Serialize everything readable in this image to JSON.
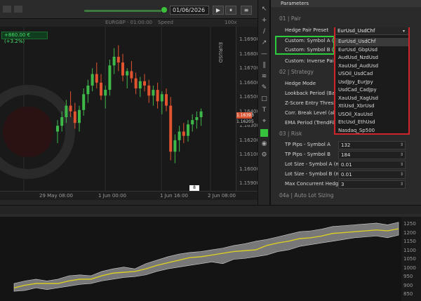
{
  "toolbar": {
    "date": "01/06/2026",
    "play_label": "▶",
    "pause_label": "⏸",
    "more_label": "≡"
  },
  "subbar": {
    "instrument": "EURGBP · 01:00:00",
    "speed_label": "Speed",
    "speed_value": "100x"
  },
  "chart": {
    "pnl_badge": "+860.00 € (+3.2%)",
    "vertical_label": "EURUSD",
    "price_marker": "1.16393",
    "price_marker_2": "1.16205",
    "small_marker": "8",
    "price_ticks": [
      "1.16900",
      "1.16800",
      "1.16700",
      "1.16600",
      "1.16500",
      "1.16400",
      "1.16300",
      "1.16200",
      "1.16100",
      "1.16000",
      "1.15900"
    ],
    "time_ticks": [
      "29 May 08:00",
      "1 Jun 00:00",
      "1 Jun 16:00",
      "2 Jun 08:00"
    ],
    "toolstrip_icons": [
      "cursor-icon",
      "crosshair-icon",
      "line-icon",
      "ray-icon",
      "hline-icon",
      "channel-icon",
      "fib-icon",
      "brush-icon",
      "shape-icon",
      "text-icon",
      "measure-icon",
      "color-swatch-icon",
      "camera-icon",
      "settings-icon"
    ],
    "candles": [
      [
        1.162,
        1.1628,
        1.1612,
        1.1624
      ],
      [
        1.1624,
        1.1634,
        1.162,
        1.163
      ],
      [
        1.163,
        1.1642,
        1.1626,
        1.1638
      ],
      [
        1.1638,
        1.1648,
        1.163,
        1.1634
      ],
      [
        1.1634,
        1.164,
        1.1622,
        1.1626
      ],
      [
        1.1626,
        1.1638,
        1.162,
        1.1635
      ],
      [
        1.1635,
        1.165,
        1.1631,
        1.1646
      ],
      [
        1.1646,
        1.1656,
        1.164,
        1.1652
      ],
      [
        1.1652,
        1.1664,
        1.1648,
        1.166
      ],
      [
        1.166,
        1.1668,
        1.165,
        1.1654
      ],
      [
        1.1654,
        1.166,
        1.1642,
        1.1645
      ],
      [
        1.1645,
        1.1652,
        1.1636,
        1.1649
      ],
      [
        1.1649,
        1.167,
        1.1645,
        1.1666
      ],
      [
        1.1666,
        1.1678,
        1.166,
        1.1672
      ],
      [
        1.1672,
        1.168,
        1.1662,
        1.1668
      ],
      [
        1.1668,
        1.1674,
        1.1655,
        1.1659
      ],
      [
        1.1659,
        1.1664,
        1.165,
        1.1662
      ],
      [
        1.1662,
        1.1669,
        1.1654,
        1.1657
      ],
      [
        1.1657,
        1.1661,
        1.1646,
        1.165
      ],
      [
        1.165,
        1.1658,
        1.1644,
        1.1655
      ],
      [
        1.1655,
        1.166,
        1.1648,
        1.1652
      ],
      [
        1.1652,
        1.1656,
        1.164,
        1.1645
      ],
      [
        1.1645,
        1.1652,
        1.1638,
        1.1649
      ],
      [
        1.1649,
        1.1654,
        1.1636,
        1.1641
      ],
      [
        1.1641,
        1.1648,
        1.1632,
        1.1646
      ],
      [
        1.1646,
        1.165,
        1.1634,
        1.1638
      ],
      [
        1.1638,
        1.1644,
        1.16,
        1.1606
      ],
      [
        1.1606,
        1.1618,
        1.1598,
        1.1614
      ],
      [
        1.1614,
        1.1624,
        1.1606,
        1.162
      ],
      [
        1.162,
        1.1626,
        1.1612,
        1.1617
      ],
      [
        1.1617,
        1.1628,
        1.1613,
        1.1625
      ],
      [
        1.1625,
        1.1632,
        1.162,
        1.1628
      ],
      [
        1.1628,
        1.1634,
        1.1622,
        1.163
      ],
      [
        1.163,
        1.1636,
        1.1624,
        1.1634
      ]
    ]
  },
  "params": {
    "header": "Parameters",
    "sections": {
      "pair": "01 | Pair",
      "strategy": "02 | Strategy",
      "risk": "03 | Risk",
      "auto": "04a | Auto Lot Sizing"
    },
    "rows": {
      "hedge_pair_preset": {
        "label": "Hedge Pair Preset",
        "value": "EurUsd_UsdChf"
      },
      "custom_symbol_a": {
        "label": "Custom: Symbol A (for...",
        "value": ""
      },
      "custom_symbol_b": {
        "label": "Custom: Symbol B (for...",
        "value": ""
      },
      "custom_inverse": {
        "label": "Custom: Inverse Pair?",
        "value": ""
      },
      "hedge_mode": {
        "label": "Hedge Mode",
        "value": ""
      },
      "lookback": {
        "label": "Lookback Period (Bars)",
        "value": ""
      },
      "zscore": {
        "label": "Z-Score Entry Threshold",
        "value": ""
      },
      "corr_break": {
        "label": "Corr. Break Level (abs)",
        "value": ""
      },
      "ema_period": {
        "label": "EMA Period (TrendFilter)",
        "value": ""
      },
      "tp_a": {
        "label": "TP Pips - Symbol A",
        "value": "132"
      },
      "tp_b": {
        "label": "TP Pips - Symbol B",
        "value": "184"
      },
      "lot_a": {
        "label": "Lot Size - Symbol A (m...",
        "value": "0.01"
      },
      "lot_b": {
        "label": "Lot Size - Symbol B (m...",
        "value": "0.01"
      },
      "max_hedges": {
        "label": "Max Concurrent Hedges",
        "value": "3"
      }
    },
    "dropdown_head": "EurUsd_UsdChf",
    "dropdown_options": [
      "EurUsd_UsdChf",
      "EurUsd_GbpUsd",
      "AudUsd_NzdUsd",
      "XauUsd_AudUsd",
      "USOil_UsdCad",
      "UsdJpy_EurJpy",
      "UsdCad_CadJpy",
      "XauUsd_XagUsd",
      "XtiUsd_XbrUsd",
      "USOil_XauUsd",
      "EtcUsd_EthUsd",
      "Nasdaq_Sp500"
    ]
  },
  "equity": {
    "ticks": [
      "1250",
      "1200",
      "1150",
      "1100",
      "1050",
      "1000",
      "950",
      "900",
      "850"
    ],
    "line_color": "#e0d21e",
    "band_color": "#9a9a9a",
    "balance": [
      880,
      895,
      905,
      905,
      905,
      920,
      930,
      930,
      950,
      965,
      970,
      975,
      990,
      1010,
      1025,
      1040,
      1055,
      1060,
      1070,
      1080,
      1090,
      1095,
      1100,
      1125,
      1140,
      1150,
      1165,
      1170,
      1180,
      1195,
      1200,
      1205,
      1210,
      1215,
      1210,
      1222
    ],
    "equity_hi": [
      905,
      920,
      930,
      920,
      930,
      950,
      955,
      950,
      975,
      990,
      1000,
      990,
      1020,
      1040,
      1060,
      1075,
      1085,
      1090,
      1100,
      1110,
      1125,
      1135,
      1150,
      1160,
      1175,
      1190,
      1205,
      1210,
      1220,
      1235,
      1240,
      1245,
      1250,
      1255,
      1245,
      1260
    ],
    "equity_lo": [
      860,
      865,
      880,
      870,
      880,
      890,
      900,
      905,
      920,
      930,
      940,
      945,
      955,
      975,
      990,
      1000,
      1010,
      1020,
      1030,
      1020,
      1045,
      1050,
      1060,
      1070,
      1090,
      1100,
      1120,
      1130,
      1140,
      1150,
      1160,
      1170,
      1175,
      1180,
      1170,
      1185
    ]
  }
}
